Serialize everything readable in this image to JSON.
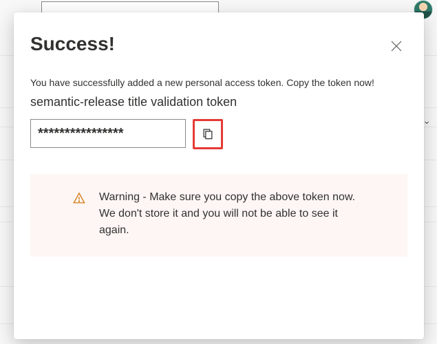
{
  "modal": {
    "title": "Success!",
    "description": "You have successfully added a new personal access token. Copy the token now!",
    "token_name": "semantic-release title validation token",
    "token_masked": "****************"
  },
  "warning": {
    "text": "Warning - Make sure you copy the above token now. We don't store it and you will not be able to see it again."
  },
  "colors": {
    "highlight": "#e53935",
    "warning_bg": "#fdf6f4",
    "warning_icon": "#d27b14"
  }
}
